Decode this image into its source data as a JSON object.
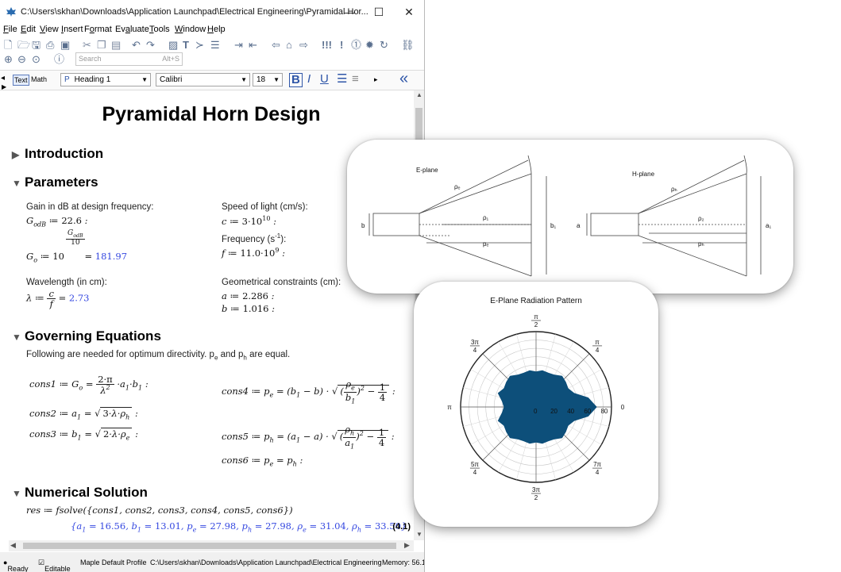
{
  "window": {
    "title": "C:\\Users\\skhan\\Downloads\\Application Launchpad\\Electrical Engineering\\Pyramidal Hor...",
    "minimize_glyph": "—",
    "maximize_glyph": "☐",
    "close_glyph": "✕"
  },
  "menu": {
    "items": [
      {
        "label": "File",
        "u": "F",
        "rest": "ile"
      },
      {
        "label": "Edit",
        "u": "E",
        "rest": "dit"
      },
      {
        "label": "View",
        "u": "V",
        "rest": "iew"
      },
      {
        "label": "Insert",
        "u": "I",
        "rest": "nsert"
      },
      {
        "label": "Format",
        "pre": "F",
        "u": "o",
        "rest": "rmat"
      },
      {
        "label": "Evaluate",
        "pre": "Ev",
        "u": "a",
        "rest": "luate"
      },
      {
        "label": "Tools",
        "u": "T",
        "rest": "ools"
      },
      {
        "label": "Window",
        "u": "W",
        "rest": "indow"
      },
      {
        "label": "Help",
        "u": "H",
        "rest": "elp"
      }
    ]
  },
  "search": {
    "placeholder": "Search",
    "shortcut": "Alt+S"
  },
  "format_bar": {
    "mode_text": "Text",
    "mode_math": "Math",
    "style_glyph": "P",
    "style": "Heading 1",
    "font": "Calibri",
    "size": "18",
    "bold": "B",
    "italic": "I",
    "underline": "U",
    "collapse": "«"
  },
  "document": {
    "title": "Pyramidal Horn Design",
    "sections": {
      "introduction": "Introduction",
      "parameters": "Parameters",
      "governing": "Governing Equations",
      "numerical": "Numerical Solution"
    },
    "params": {
      "gain_label": "Gain in dB at design frequency:",
      "gain_value": "22.6",
      "go_result": "181.97",
      "wavelength_label": "Wavelength (in cm):",
      "lambda_result": "2.73",
      "speed_label": "Speed of light (cm/s):",
      "frequency_label": "Frequency (s",
      "geo_label": "Geometrical constraints (cm):",
      "a_value": "2.286",
      "b_value": "1.016"
    },
    "governing_text": "Following are needed for optimum directivity.",
    "governing_text_tail": "are equal.",
    "solve_cmd": "res ≔ fsolve({cons1, cons2, cons3, cons4, cons5, cons6})",
    "solution": {
      "a1": "16.56",
      "b1": "13.01",
      "pe": "27.98",
      "ph": "27.98",
      "rho_e": "31.04",
      "rho_h": "33.50",
      "label": "(4.1)"
    }
  },
  "status": {
    "ready": "Ready",
    "editable": "Editable",
    "profile": "Maple Default Profile",
    "path": "C:\\Users\\skhan\\Downloads\\Application Launchpad\\Electrical Engineering",
    "memory": "Memory: 56.1"
  },
  "diagram": {
    "e_plane": {
      "title": "E-plane",
      "rho_e": "ρₑ",
      "rho_1": "ρ₁",
      "p_e": "pₑ",
      "b": "b",
      "b_1": "b₁"
    },
    "h_plane": {
      "title": "H-plane",
      "rho_h": "ρₕ",
      "rho_2": "ρ₂",
      "p_h": "pₕ",
      "a": "a",
      "a_1": "a₁"
    }
  },
  "polar": {
    "title": "E-Plane Radiation Pattern",
    "angle_labels": {
      "top": "π/2",
      "top_left": "3π/4",
      "top_right": "π/4",
      "left": "π",
      "right": "0",
      "bottom_left": "5π/4",
      "bottom": "3π/2",
      "bottom_right": "7π/4"
    },
    "radial_ticks": [
      "0",
      "20",
      "40",
      "60",
      "80"
    ],
    "fill_color": "#0d4f7a"
  },
  "chart_data": {
    "type": "polar-area",
    "title": "E-Plane Radiation Pattern",
    "r_ticks": [
      0,
      20,
      40,
      60,
      80
    ],
    "r_max": 90,
    "theta_labels": [
      "0",
      "π/4",
      "π/2",
      "3π/4",
      "π",
      "5π/4",
      "3π/2",
      "7π/4"
    ],
    "series": [
      {
        "theta_deg": [
          0,
          10,
          20,
          30,
          40,
          50,
          60,
          70,
          80,
          90,
          100,
          110,
          120,
          130,
          140,
          150,
          160,
          170,
          180,
          190,
          200,
          210,
          220,
          230,
          240,
          250,
          260,
          270,
          280,
          290,
          300,
          310,
          320,
          330,
          340,
          350,
          360
        ],
        "r": [
          72,
          63,
          48,
          44,
          46,
          48,
          44,
          43,
          44,
          42,
          44,
          43,
          44,
          48,
          46,
          44,
          48,
          41,
          38,
          41,
          48,
          44,
          46,
          48,
          44,
          43,
          44,
          42,
          44,
          43,
          44,
          48,
          46,
          44,
          48,
          63,
          72
        ]
      }
    ]
  }
}
